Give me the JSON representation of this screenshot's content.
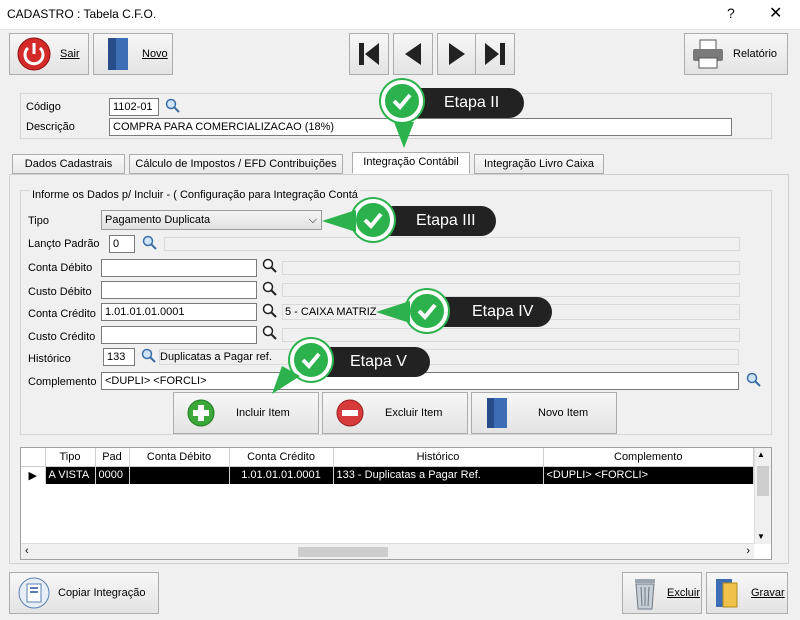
{
  "window": {
    "title": "CADASTRO : Tabela C.F.O.",
    "help": "?",
    "close": "✕"
  },
  "toolbar": {
    "sair": "Sair",
    "novo": "Novo",
    "relatorio": "Relatório"
  },
  "header": {
    "codigo_label": "Código",
    "codigo_value": "1102-01",
    "descricao_label": "Descrição",
    "descricao_value": "COMPRA PARA COMERCIALIZACAO (18%)"
  },
  "tabs": [
    {
      "label": "Dados Cadastrais"
    },
    {
      "label": "Cálculo de Impostos / EFD Contribuições"
    },
    {
      "label": "Integração Contábil"
    },
    {
      "label": "Integração Livro Caixa"
    }
  ],
  "form": {
    "group_title": "Informe os Dados p/ Incluir  -  ( Configuração para  Integração  Contá",
    "tipo_label": "Tipo",
    "tipo_value": "Pagamento Duplicata",
    "lancto_label": "Lançto Padrão",
    "lancto_value": "0",
    "conta_debito_label": "Conta Débito",
    "conta_debito_value": "",
    "custo_debito_label": "Custo Débito",
    "custo_debito_value": "",
    "conta_credito_label": "Conta Crédito",
    "conta_credito_value": "1.01.01.01.0001",
    "conta_credito_desc": "5 - CAIXA MATRIZ",
    "custo_credito_label": "Custo Crédito",
    "custo_credito_value": "",
    "historico_label": "Histórico",
    "historico_value": "133",
    "historico_desc": "Duplicatas a Pagar ref.",
    "complemento_label": "Complemento",
    "complemento_value": "<DUPLI> <FORCLI>"
  },
  "actions": {
    "incluir": "Incluir Item",
    "excluir": "Excluir Item",
    "novo_item": "Novo Item"
  },
  "callouts": {
    "etapa2": "Etapa II",
    "etapa3": "Etapa III",
    "etapa4": "Etapa IV",
    "etapa5": "Etapa V"
  },
  "grid": {
    "headers": [
      "Tipo",
      "Pad",
      "Conta Débito",
      "Conta Crédito",
      "Histórico",
      "Complemento"
    ],
    "rows": [
      [
        "A VISTA",
        "0000",
        "",
        "1.01.01.01.0001",
        "133 - Duplicatas a Pagar Ref.",
        "<DUPLI> <FORCLI>"
      ]
    ]
  },
  "footer": {
    "copiar": "Copiar Integração",
    "excluir": "Excluir",
    "gravar": "Gravar"
  }
}
